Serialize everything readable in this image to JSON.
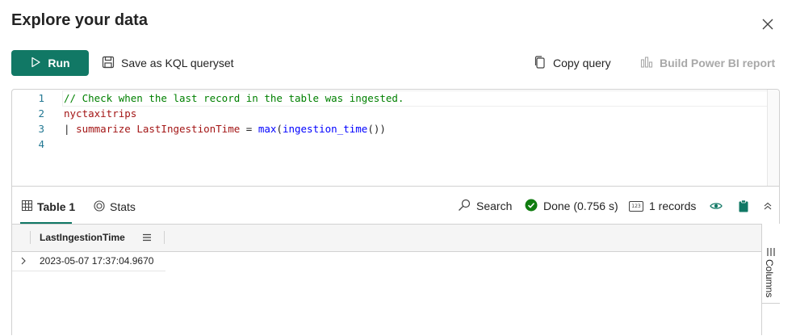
{
  "dialog": {
    "title": "Explore your data"
  },
  "toolbar": {
    "run_label": "Run",
    "save_label": "Save as KQL queryset",
    "copy_label": "Copy query",
    "powerbi_label": "Build Power BI report"
  },
  "editor": {
    "lines": [
      {
        "num": "1",
        "parts": [
          {
            "t": "// Check when the last record in the table was ingested.",
            "k": "comment"
          }
        ]
      },
      {
        "num": "2",
        "parts": [
          {
            "t": "nyctaxitrips",
            "k": "table"
          }
        ]
      },
      {
        "num": "3",
        "parts": [
          {
            "t": "| ",
            "k": "op"
          },
          {
            "t": "summarize",
            "k": "kw"
          },
          {
            "t": " ",
            "k": "plain"
          },
          {
            "t": "LastIngestionTime",
            "k": "table"
          },
          {
            "t": " = ",
            "k": "op"
          },
          {
            "t": "max",
            "k": "fn"
          },
          {
            "t": "(",
            "k": "plain"
          },
          {
            "t": "ingestion_time",
            "k": "fn"
          },
          {
            "t": "())",
            "k": "plain"
          }
        ]
      },
      {
        "num": "4",
        "parts": []
      }
    ]
  },
  "results": {
    "tabs": [
      {
        "label": "Table 1"
      },
      {
        "label": "Stats"
      }
    ],
    "search_label": "Search",
    "status_label": "Done (0.756 s)",
    "records_label": "1 records",
    "records_icon_text": "123",
    "columns_label": "Columns",
    "grid": {
      "columns": [
        "LastIngestionTime"
      ],
      "rows": [
        [
          "2023-05-07 17:37:04.9670"
        ]
      ]
    }
  },
  "colors": {
    "accent": "#117865",
    "success": "#107c10"
  }
}
